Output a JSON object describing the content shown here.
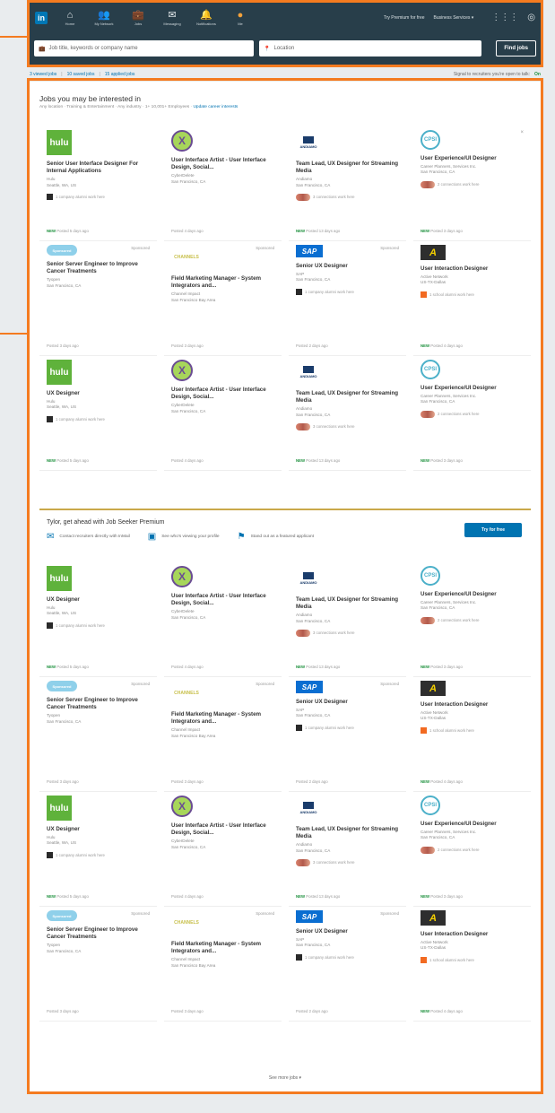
{
  "nav": {
    "logo": "in",
    "items": [
      {
        "label": "Home",
        "glyph": "⌂"
      },
      {
        "label": "My Network",
        "glyph": "👥"
      },
      {
        "label": "Jobs",
        "glyph": "💼"
      },
      {
        "label": "Messaging",
        "glyph": "✉"
      },
      {
        "label": "Notifications",
        "glyph": "🔔"
      },
      {
        "label": "Me",
        "glyph": "●"
      }
    ],
    "premium_link": "Try Premium for free",
    "business_services": "Business Services ▾"
  },
  "search": {
    "keywords_placeholder": "Job title, keywords or company name",
    "location_placeholder": "Location",
    "find_jobs": "Find jobs"
  },
  "subbar": {
    "viewed": "3 viewed jobs",
    "saved": "10 saved jobs",
    "applied": "15 applied jobs",
    "signal": "Signal to recruiters you're open to talk:",
    "signal_state": "On"
  },
  "panel": {
    "title": "Jobs you may be interested in",
    "subtitle": "Any location · Training & Entertainment · Any industry · 1+ 10,001+ Employees ·",
    "update_link": "Update career interests"
  },
  "jobs": [
    {
      "logo": "hulu",
      "logo_text": "hulu",
      "title": "Senior User Interface Designer For Internal Applications",
      "company": "Hulu",
      "location": "Seattle, WA, US",
      "conn": "sq",
      "conn_text": "1 company alumni work here",
      "foot_new": "NEW",
      "foot": "Posted 5 days ago",
      "closable": true
    },
    {
      "logo": "x",
      "logo_text": "X",
      "title": "User Interface Artist - User Interface Design, Social...",
      "company": "CyberDelete",
      "location": "San Francisco, CA",
      "conn": "",
      "conn_text": "",
      "foot_new": "",
      "foot": "Posted 4 days ago"
    },
    {
      "logo": "and",
      "logo_text": "ANDIAMO",
      "title": "Team Lead, UX Designer for Streaming Media",
      "company": "Andiamo",
      "location": "San Francisco, CA",
      "conn": "faces",
      "conn_text": "3 connections work here",
      "foot_new": "NEW",
      "foot": "Posted 13 days ago"
    },
    {
      "logo": "csi",
      "logo_text": "CPSI",
      "title": "User Experience/UI Designer",
      "company": "Career Planners, Services Inc.",
      "location": "San Francisco, CA",
      "conn": "faces",
      "conn_text": "2 connections work here",
      "foot_new": "NEW",
      "foot": "Posted 3 days ago",
      "closable": true
    },
    {
      "logo": "spon",
      "logo_text": "Sponsored",
      "title": "Senior Server Engineer to Improve Cancer Treatments",
      "company": "Tyopen",
      "location": "San Francisco, CA",
      "conn": "",
      "conn_text": "",
      "foot_new": "",
      "foot": "Posted 3 days ago",
      "sponsored": "Sponsored"
    },
    {
      "logo": "chan",
      "logo_text": "CHANNELS",
      "title": "Field Marketing Manager - System Integrators and...",
      "company": "Channel Impact",
      "location": "San Francisco Bay Area",
      "conn": "",
      "conn_text": "",
      "foot_new": "",
      "foot": "Posted 3 days ago",
      "sponsored": "Sponsored"
    },
    {
      "logo": "sap",
      "logo_text": "SAP",
      "title": "Senior UX Designer",
      "company": "SAP",
      "location": "San Francisco, CA",
      "conn": "sq",
      "conn_text": "1 company alumni work here",
      "foot_new": "",
      "foot": "Posted 2 days ago",
      "sponsored": "Sponsored"
    },
    {
      "logo": "ax",
      "logo_text": "A",
      "title": "User Interaction Designer",
      "company": "Active Network",
      "location": "US-TX-Dallas",
      "conn": "su",
      "conn_text": "1 school alumni work here",
      "foot_new": "NEW",
      "foot": "Posted 4 days ago"
    },
    {
      "logo": "hulu",
      "logo_text": "hulu",
      "title": "UX Designer",
      "company": "Hulu",
      "location": "Seattle, WA, US",
      "conn": "sq",
      "conn_text": "1 company alumni work here",
      "foot_new": "NEW",
      "foot": "Posted 5 days ago"
    },
    {
      "logo": "x",
      "logo_text": "X",
      "title": "User Interface Artist - User Interface Design, Social...",
      "company": "CyberDelete",
      "location": "San Francisco, CA",
      "conn": "",
      "conn_text": "",
      "foot_new": "",
      "foot": "Posted 4 days ago"
    },
    {
      "logo": "and",
      "logo_text": "ANDIAMO",
      "title": "Team Lead, UX Designer for Streaming Media",
      "company": "Andiamo",
      "location": "San Francisco, CA",
      "conn": "faces",
      "conn_text": "3 connections work here",
      "foot_new": "NEW",
      "foot": "Posted 13 days ago"
    },
    {
      "logo": "csi",
      "logo_text": "CPSI",
      "title": "User Experience/UI Designer",
      "company": "Career Planners, Services Inc.",
      "location": "San Francisco, CA",
      "conn": "faces",
      "conn_text": "2 connections work here",
      "foot_new": "NEW",
      "foot": "Posted 3 days ago"
    }
  ],
  "premium": {
    "title": "Tylor, get ahead with Job Seeker Premium",
    "item1": "Contact recruiters directly with InMail",
    "item2": "See who's viewing your profile",
    "item3": "Stand out as a featured applicant",
    "try": "Try for free"
  },
  "see_more": "See more jobs ▾"
}
